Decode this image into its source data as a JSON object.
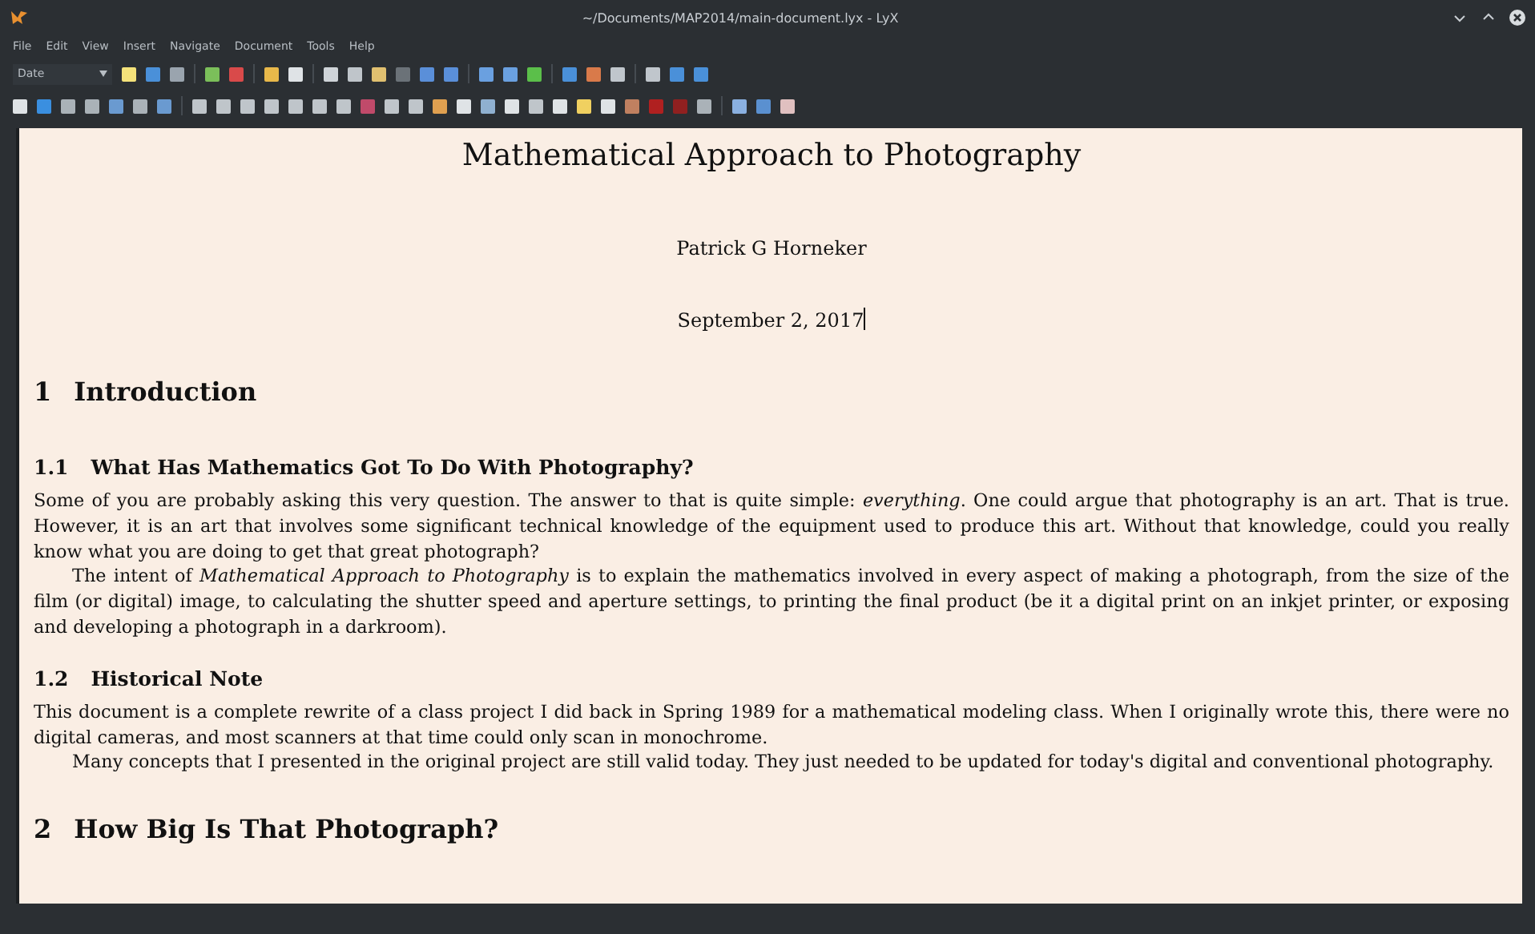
{
  "window": {
    "title": "~/Documents/MAP2014/main-document.lyx - LyX"
  },
  "menu": [
    "File",
    "Edit",
    "View",
    "Insert",
    "Navigate",
    "Document",
    "Tools",
    "Help"
  ],
  "toolbar": {
    "paragraph_style": "Date"
  },
  "document": {
    "title": "Mathematical Approach to Photography",
    "author": "Patrick G Horneker",
    "date": "September 2, 2017",
    "blocks": [
      {
        "kind": "section",
        "number": "1",
        "text": "Introduction"
      },
      {
        "kind": "subsection",
        "number": "1.1",
        "text": "What Has Mathematics Got To Do With Photography?"
      },
      {
        "kind": "paragraph",
        "indented": false,
        "text": "Some of you are probably asking this very question. The answer to that is quite simple: *everything*. One could argue that photography is an art. That is true. However, it is an art that involves some significant technical knowledge of the equipment used to produce this art. Without that knowledge, could you really know what you are doing to get that great photograph?"
      },
      {
        "kind": "paragraph",
        "indented": true,
        "text": "The intent of *Mathematical Approach to Photography* is to explain the mathematics involved in every aspect of making a photograph, from the size of the film (or digital) image, to calculating the shutter speed and aperture settings, to printing the final product (be it a digital print on an inkjet printer, or exposing and developing a photograph in a darkroom)."
      },
      {
        "kind": "subsection",
        "number": "1.2",
        "text": "Historical Note"
      },
      {
        "kind": "paragraph",
        "indented": false,
        "text": "This document is a complete rewrite of a class project I did back in Spring 1989 for a mathematical modeling class. When I originally wrote this, there were no digital cameras, and most scanners at that time could only scan in monochrome."
      },
      {
        "kind": "paragraph",
        "indented": true,
        "text": "Many concepts that I presented in the original project are still valid today. They just needed to be updated for today's digital and conventional photography."
      },
      {
        "kind": "section",
        "number": "2",
        "text": "How Big Is That Photograph?"
      }
    ]
  }
}
